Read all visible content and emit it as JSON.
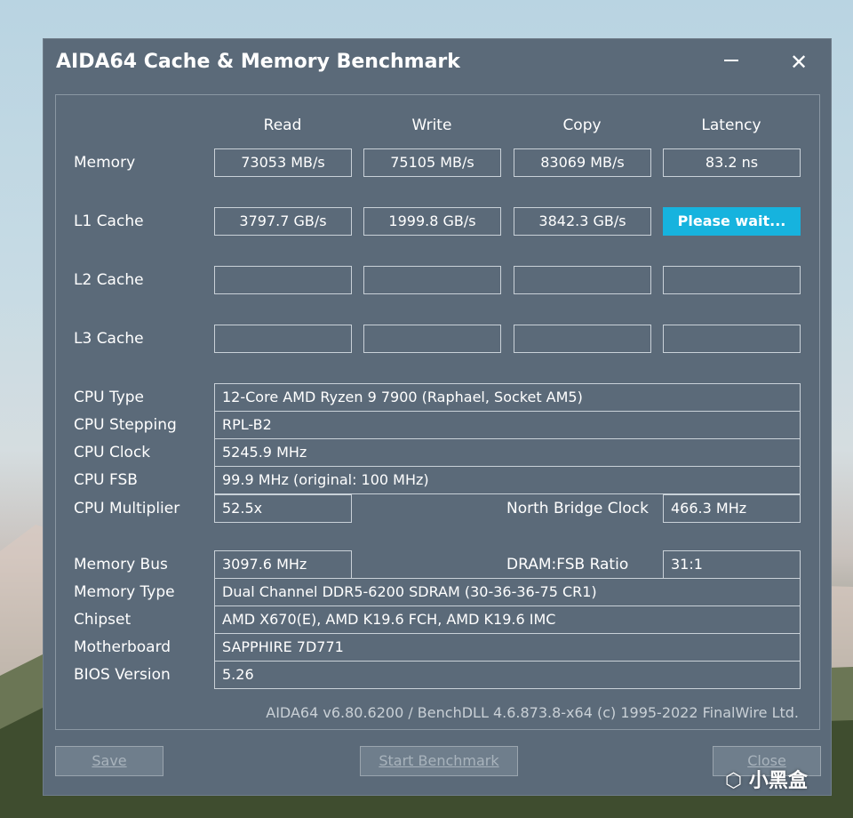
{
  "window": {
    "title": "AIDA64 Cache & Memory Benchmark"
  },
  "headers": {
    "read": "Read",
    "write": "Write",
    "copy": "Copy",
    "latency": "Latency"
  },
  "rows": {
    "memory": {
      "label": "Memory",
      "read": "73053 MB/s",
      "write": "75105 MB/s",
      "copy": "83069 MB/s",
      "latency": "83.2 ns"
    },
    "l1": {
      "label": "L1 Cache",
      "read": "3797.7 GB/s",
      "write": "1999.8 GB/s",
      "copy": "3842.3 GB/s",
      "latency": "Please wait..."
    },
    "l2": {
      "label": "L2 Cache"
    },
    "l3": {
      "label": "L3 Cache"
    }
  },
  "cpu": {
    "type_label": "CPU Type",
    "type": "12-Core AMD Ryzen 9 7900  (Raphael, Socket AM5)",
    "stepping_label": "CPU Stepping",
    "stepping": "RPL-B2",
    "clock_label": "CPU Clock",
    "clock": "5245.9 MHz",
    "fsb_label": "CPU FSB",
    "fsb": "99.9 MHz  (original: 100 MHz)",
    "multiplier_label": "CPU Multiplier",
    "multiplier": "52.5x",
    "nb_clock_label": "North Bridge Clock",
    "nb_clock": "466.3 MHz"
  },
  "memory_info": {
    "bus_label": "Memory Bus",
    "bus": "3097.6 MHz",
    "ratio_label": "DRAM:FSB Ratio",
    "ratio": "31:1",
    "type_label": "Memory Type",
    "type": "Dual Channel DDR5-6200 SDRAM  (30-36-36-75 CR1)",
    "chipset_label": "Chipset",
    "chipset": "AMD X670(E), AMD K19.6 FCH, AMD K19.6 IMC",
    "motherboard_label": "Motherboard",
    "motherboard": "SAPPHIRE 7D771",
    "bios_label": "BIOS Version",
    "bios": "5.26"
  },
  "footer": "AIDA64 v6.80.6200 / BenchDLL 4.6.873.8-x64  (c) 1995-2022 FinalWire Ltd.",
  "buttons": {
    "save": "Save",
    "start": "Start Benchmark",
    "close": "Close"
  },
  "watermark": "小黑盒",
  "colors": {
    "window_bg": "#5b6a79",
    "accent": "#16b3de"
  }
}
